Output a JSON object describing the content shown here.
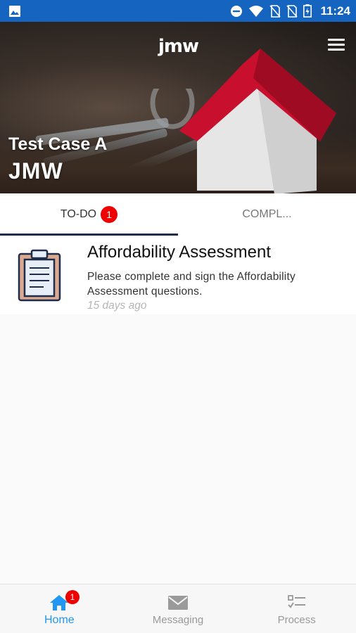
{
  "status_bar": {
    "time": "11:24",
    "icons": [
      "image-icon",
      "do-not-disturb-icon",
      "wifi-icon",
      "no-sim-icon",
      "no-sim-icon",
      "battery-icon"
    ]
  },
  "header": {
    "logo_text": "jmw",
    "title_line1": "Test Case A",
    "title_line2": "JMW",
    "menu_icon": "hamburger-menu-icon"
  },
  "tabs": [
    {
      "label": "TO-DO",
      "badge": "1",
      "active": true
    },
    {
      "label": "COMPL...",
      "active": false
    }
  ],
  "todo_items": [
    {
      "icon": "clipboard-icon",
      "title": "Affordability Assessment",
      "description": "Please complete and sign the Affordability Assessment questions.",
      "age": "15 days ago"
    }
  ],
  "bottom_nav": [
    {
      "label": "Home",
      "icon": "home-icon",
      "badge": "1",
      "active": true
    },
    {
      "label": "Messaging",
      "icon": "mail-icon",
      "active": false
    },
    {
      "label": "Process",
      "icon": "checklist-icon",
      "active": false
    }
  ],
  "colors": {
    "status_bar": "#1565c0",
    "accent": "#2196f3",
    "badge": "#ee0000",
    "tab_underline": "#1f2d4a",
    "roof": "#c8102e"
  }
}
